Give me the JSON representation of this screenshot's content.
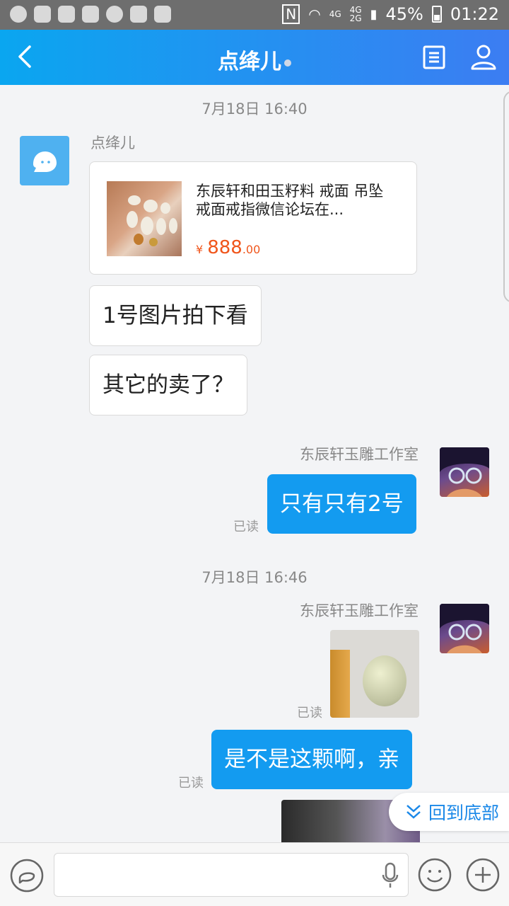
{
  "status_bar": {
    "signal_4g_a": "4G",
    "signal_4g_b": "4G",
    "signal_2g": "2G",
    "battery": "45%",
    "time": "01:22"
  },
  "header": {
    "title": "点绛儿"
  },
  "messages": {
    "time1": "7月18日 16:40",
    "peer_name": "点绛儿",
    "product_title": "东辰轩和田玉籽料 戒面 吊坠  戒面戒指微信论坛在...",
    "price_symbol": "¥",
    "price_int": "888",
    "price_dec": ".00",
    "msg1": "1号图片拍下看",
    "msg2": "其它的卖了？",
    "shop_name_1": "东辰轩玉雕工作室",
    "reply1": "只有只有2号",
    "read1": "已读",
    "time2": "7月18日 16:46",
    "shop_name_2": "东辰轩玉雕工作室",
    "read2": "已读",
    "reply2": "是不是这颗啊，亲",
    "read3": "已读"
  },
  "back_to_bottom": "回到底部",
  "icons": [
    "back-icon",
    "document-icon",
    "user-icon",
    "chat-bubble-icon",
    "microphone-icon",
    "emoji-icon",
    "plus-icon",
    "chevron-down-icon"
  ],
  "colors": {
    "header_start": "#0aa6f0",
    "header_end": "#3c7df2",
    "outgoing_bubble": "#139bf0",
    "price": "#f0561c",
    "link": "#1a88e8"
  }
}
